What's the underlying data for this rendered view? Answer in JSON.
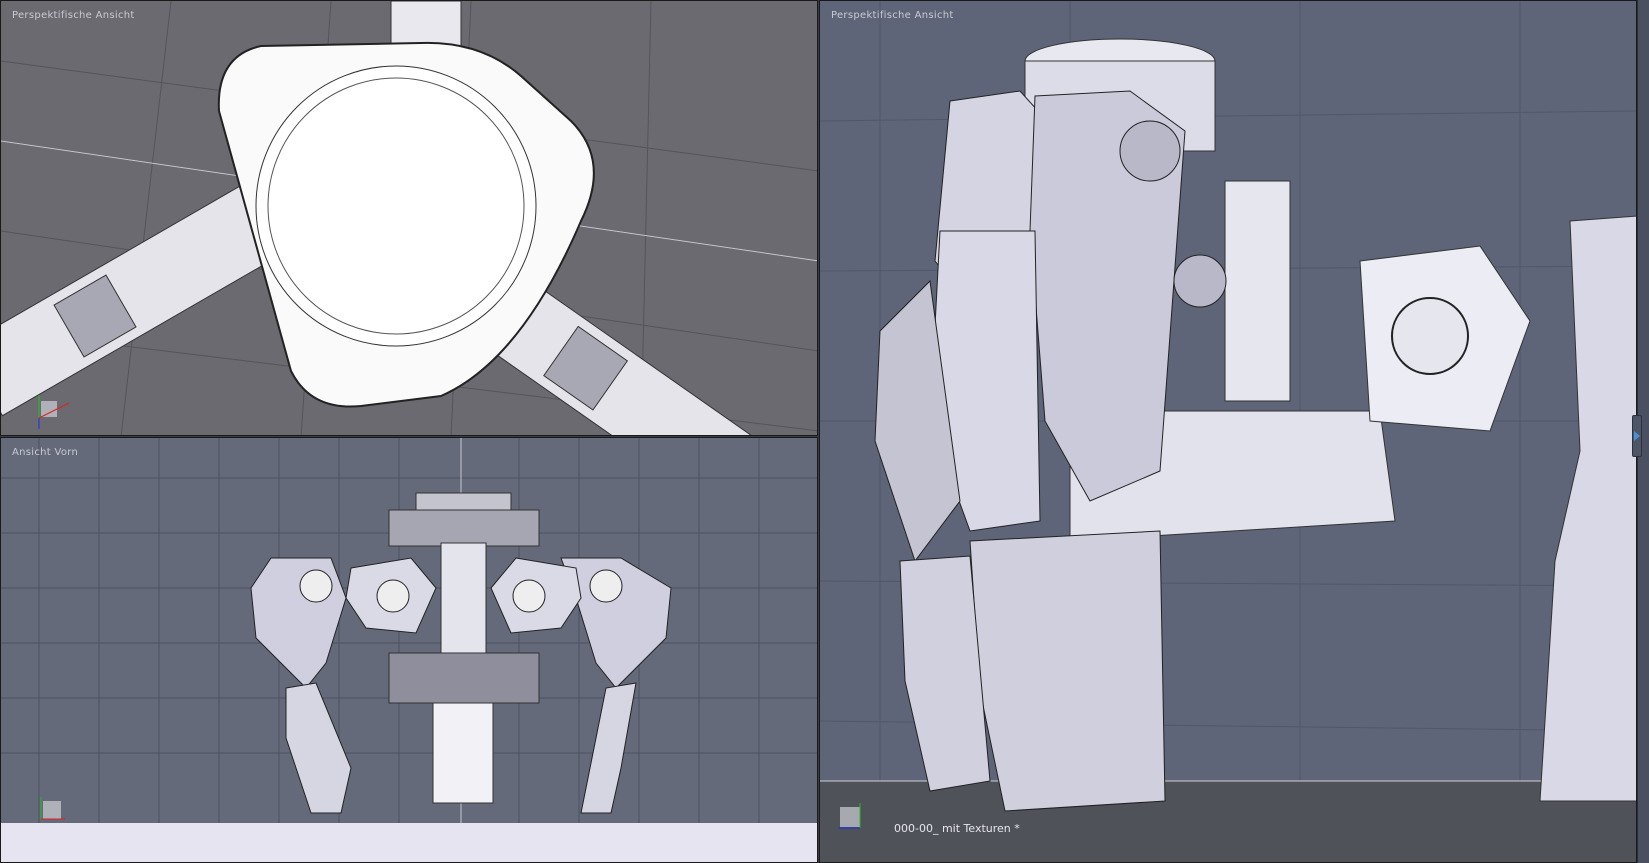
{
  "viewports": {
    "top_left": {
      "label": "Perspektifische Ansicht"
    },
    "bottom_left": {
      "label": "Ansicht Vorn"
    },
    "right": {
      "label": "Perspektifische Ansicht",
      "scene_name": "000-00_ mit Texturen *"
    }
  },
  "axes": {
    "x": "X",
    "y": "Y",
    "z": "Z"
  },
  "colors": {
    "axis_x": "#e02020",
    "axis_y": "#20c020",
    "axis_z": "#2030e0",
    "collapse_arrow": "#4a8fd8"
  }
}
